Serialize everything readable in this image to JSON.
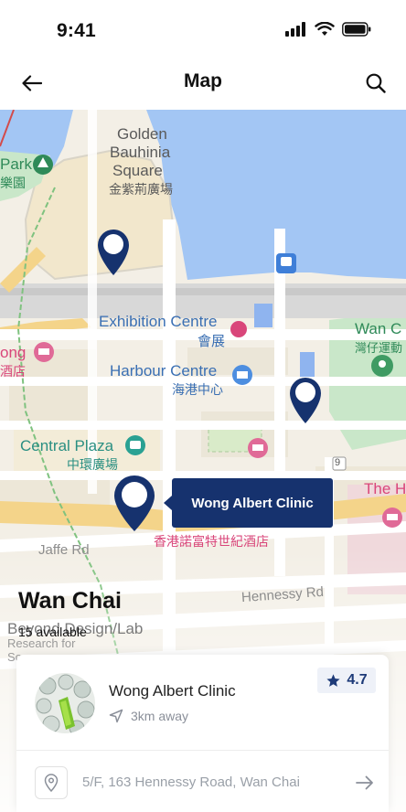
{
  "status_bar": {
    "time": "9:41"
  },
  "header": {
    "title": "Map"
  },
  "map": {
    "labels": {
      "golden_1": "Golden",
      "golden_2": "Bauhinia",
      "golden_3": "Square",
      "golden_cn": "金紫荊廣場",
      "park": "Park",
      "park_cn": "樂園",
      "exhibition": "Exhibition Centre",
      "exhibition_cn": "會展",
      "harbour": "Harbour Centre",
      "harbour_cn": "海港中心",
      "central_plaza": "Central Plaza",
      "central_plaza_cn": "中環廣場",
      "wan_c": "Wan C",
      "wan_c_cn": "灣仔運動",
      "ong": "ong",
      "ong_cn": "酒店",
      "the_h": "The H",
      "renaissance_cn": "香港諾富特世紀酒店",
      "jaffe": "Jaffe Rd",
      "hennessy": "Hennessy Rd",
      "beyond": "Beyond Design/Lab",
      "research_1": "Research for",
      "research_2": "So",
      "street_num": "9"
    },
    "selected_callout": "Wong Albert Clinic",
    "area_title": "Wan Chai",
    "available_count": "15 available"
  },
  "clinic_card": {
    "name": "Wong Albert Clinic",
    "distance": "3km away",
    "rating": "4.7",
    "address": "5/F, 163 Hennessy Road, Wan Chai"
  },
  "colors": {
    "pin": "#16326e",
    "water": "#9fc2f3",
    "park": "#c9e7c9",
    "road": "#ffffff",
    "highway": "#f4d48a"
  },
  "icons": [
    "back-arrow-icon",
    "search-icon",
    "signal-icon",
    "wifi-icon",
    "battery-icon",
    "map-pin-icon",
    "star-icon",
    "navigation-icon",
    "location-pin-icon",
    "arrow-right-icon"
  ]
}
